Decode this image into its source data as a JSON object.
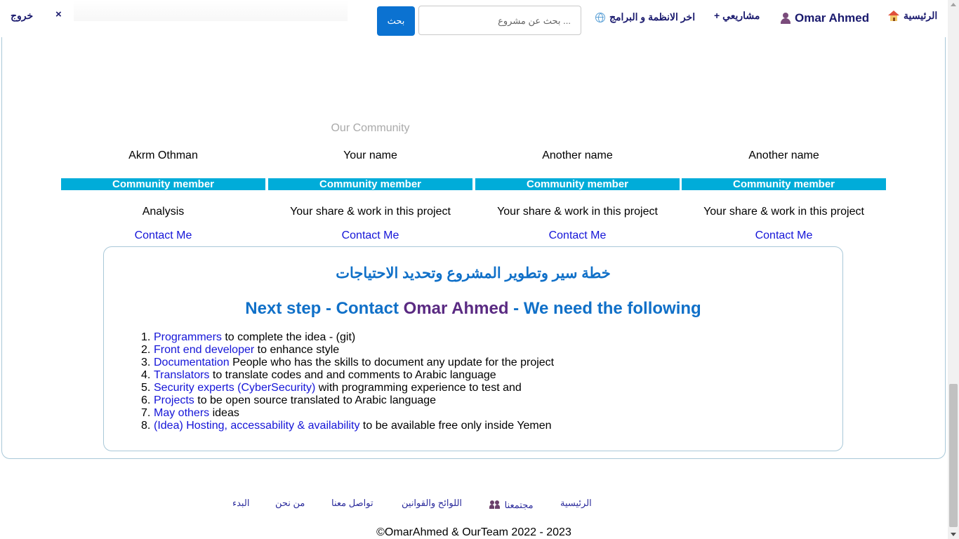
{
  "navbar": {
    "logout_label": "خروج",
    "close_label": "×",
    "search_button": "بحث",
    "search_placeholder": "... بحث عن مشروع",
    "home_label": "الرئيسية",
    "user_name": "Omar Ahmed",
    "projects_label": "مشاريعي +",
    "latest_label": "اخر الانظمة و البرامج",
    "icons": {
      "home": "home-icon",
      "user": "user-icon",
      "globe": "globe-icon"
    }
  },
  "community": {
    "heading": "Our Community",
    "members": [
      {
        "name": "Akrm Othman",
        "role": "Community member",
        "desc": "Analysis",
        "contact": "Contact Me"
      },
      {
        "name": "Your name",
        "role": "Community member",
        "desc": "Your share & work in this project",
        "contact": "Contact Me"
      },
      {
        "name": "Another name",
        "role": "Community member",
        "desc": "Your share & work in this project",
        "contact": "Contact Me"
      },
      {
        "name": "Another name",
        "role": "Community member",
        "desc": "Your share & work in this project",
        "contact": "Contact Me"
      }
    ]
  },
  "plan": {
    "title": "خطة سير وتطوير المشروع وتحديد الاحتياجات",
    "subtitle_prefix": "Next step - Contact ",
    "subtitle_owner": "Omar Ahmed",
    "subtitle_suffix": " - We need the following",
    "needs": [
      {
        "num": "1.",
        "link": "Programmers",
        "text": " to complete the idea - (git)"
      },
      {
        "num": "2.",
        "link": "Front end developer",
        "text": " to enhance style"
      },
      {
        "num": "3.",
        "link": "Documentation",
        "text": " People who has the skills to document any update for the project"
      },
      {
        "num": "4.",
        "link": "Translators",
        "text": " to translate codes and and comments to Arabic language"
      },
      {
        "num": "5.",
        "link": "Security experts (CyberSecurity)",
        "text": " with programming experience to test and"
      },
      {
        "num": "6.",
        "link": "Projects",
        "text": " to be open source translated to Arabic language"
      },
      {
        "num": "7.",
        "link": "May others",
        "text": " ideas"
      },
      {
        "num": "8.",
        "link": "(Idea) Hosting, accessability & availability",
        "text": " to be available free only inside Yemen"
      }
    ]
  },
  "footer": {
    "links": {
      "start": "البدء",
      "about": "من نحن",
      "contact": "تواصل معنا",
      "rules": "اللوائح والقوانين",
      "community": "مجتمعنا",
      "home": "الرئيسية"
    },
    "copyright": "©OmarAhmed & OurTeam 2022 - 2023"
  },
  "colors": {
    "accent": "#0b72d1",
    "community_bar": "#00acd9",
    "link": "#1515d8",
    "nav_text": "#1a1a6e",
    "owner_name": "#5a2a82"
  }
}
